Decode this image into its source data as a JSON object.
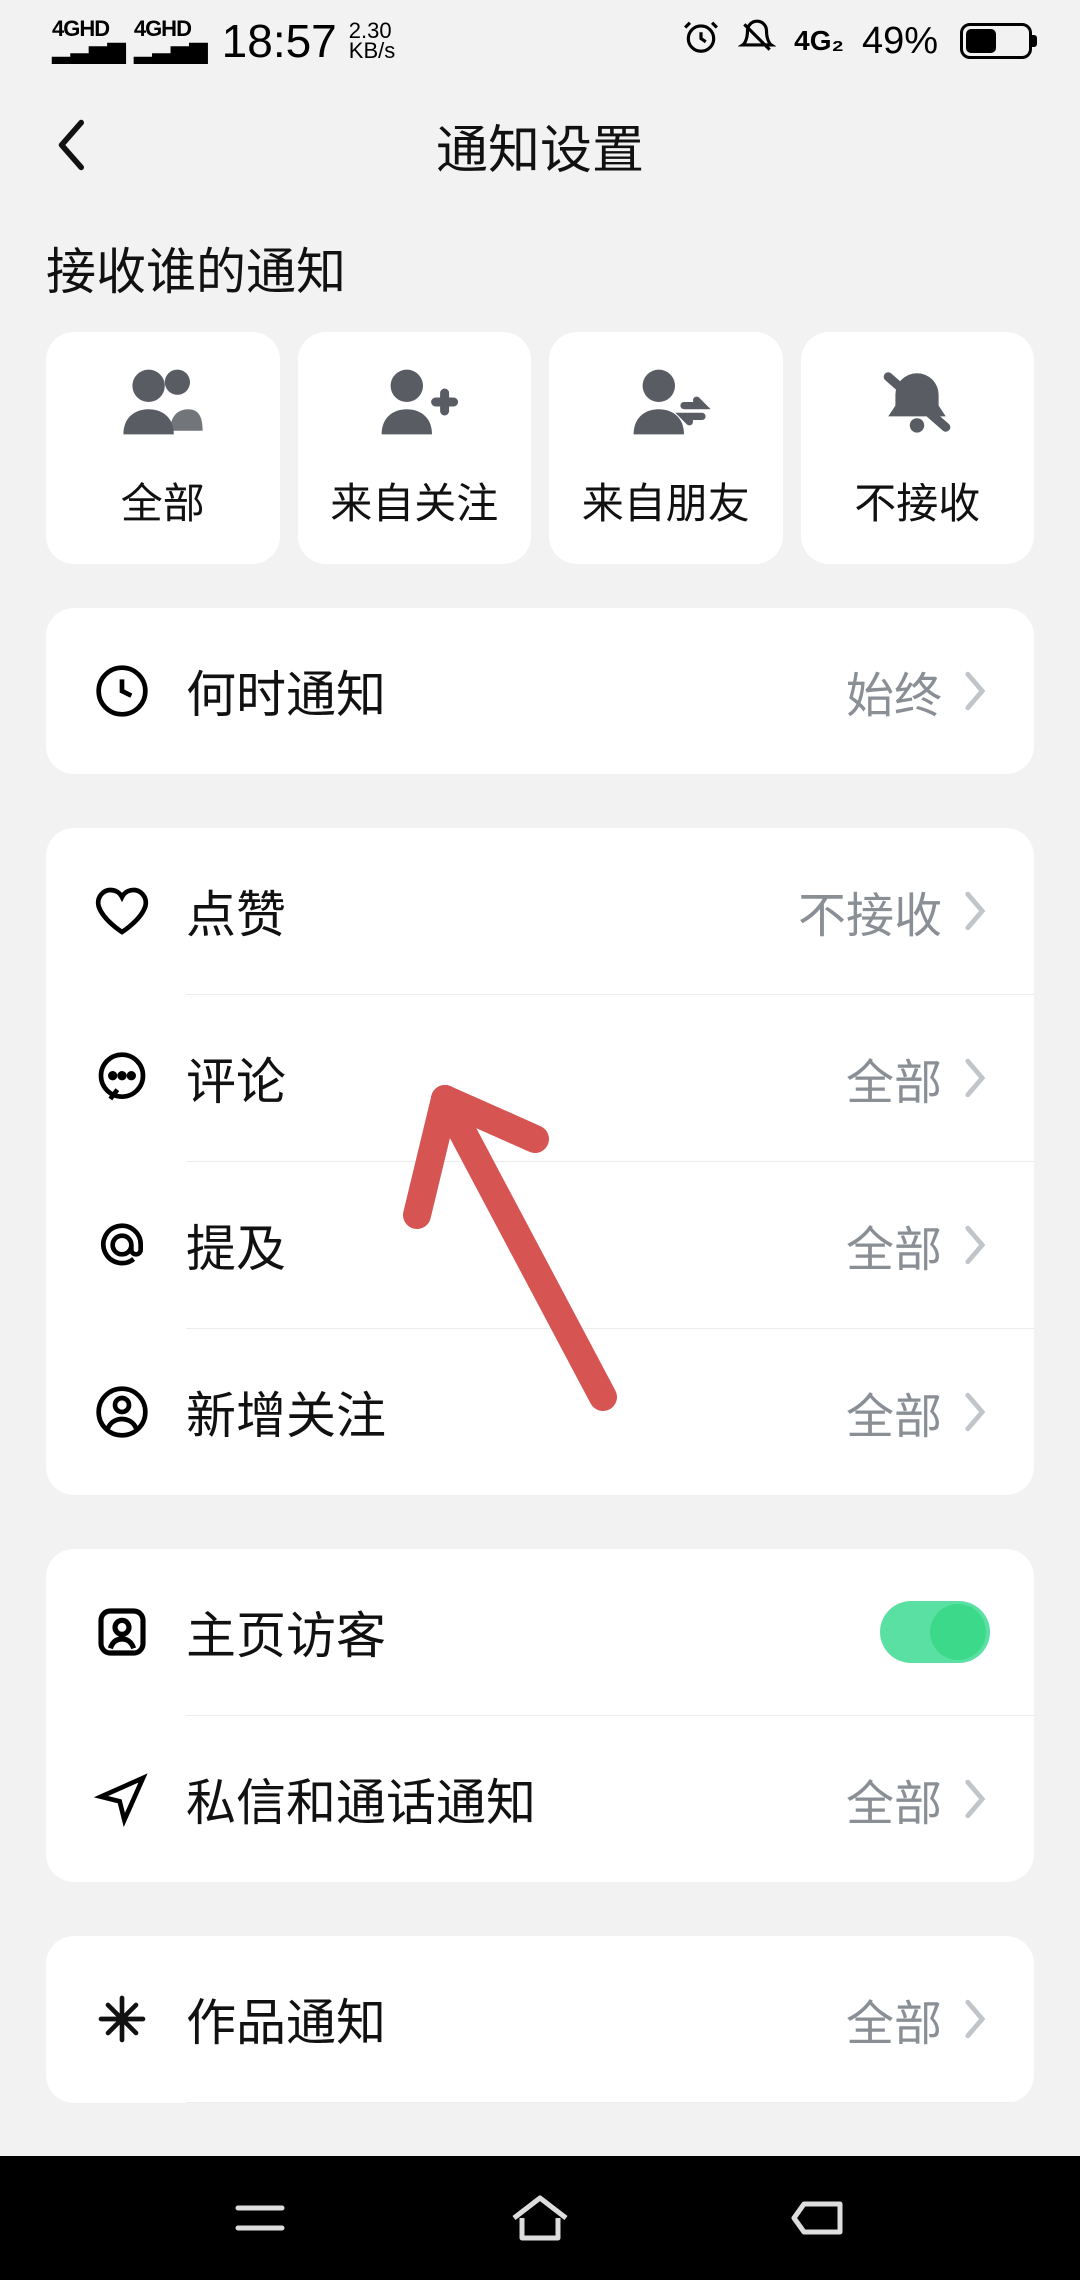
{
  "status": {
    "sig1": "4GHD",
    "sig2": "4GHD",
    "time": "18:57",
    "speed_num": "2.30",
    "speed_unit": "KB/s",
    "network": "4G₂",
    "battery": "49%"
  },
  "header": {
    "title": "通知设置"
  },
  "section_title": "接收谁的通知",
  "tiles": [
    {
      "label": "全部"
    },
    {
      "label": "来自关注"
    },
    {
      "label": "来自朋友"
    },
    {
      "label": "不接收"
    }
  ],
  "when": {
    "label": "何时通知",
    "value": "始终"
  },
  "group1": [
    {
      "label": "点赞",
      "value": "不接收"
    },
    {
      "label": "评论",
      "value": "全部"
    },
    {
      "label": "提及",
      "value": "全部"
    },
    {
      "label": "新增关注",
      "value": "全部"
    }
  ],
  "group2": {
    "visitor_label": "主页访客",
    "dm_label": "私信和通话通知",
    "dm_value": "全部"
  },
  "group3": {
    "works_label": "作品通知",
    "works_value": "全部"
  }
}
